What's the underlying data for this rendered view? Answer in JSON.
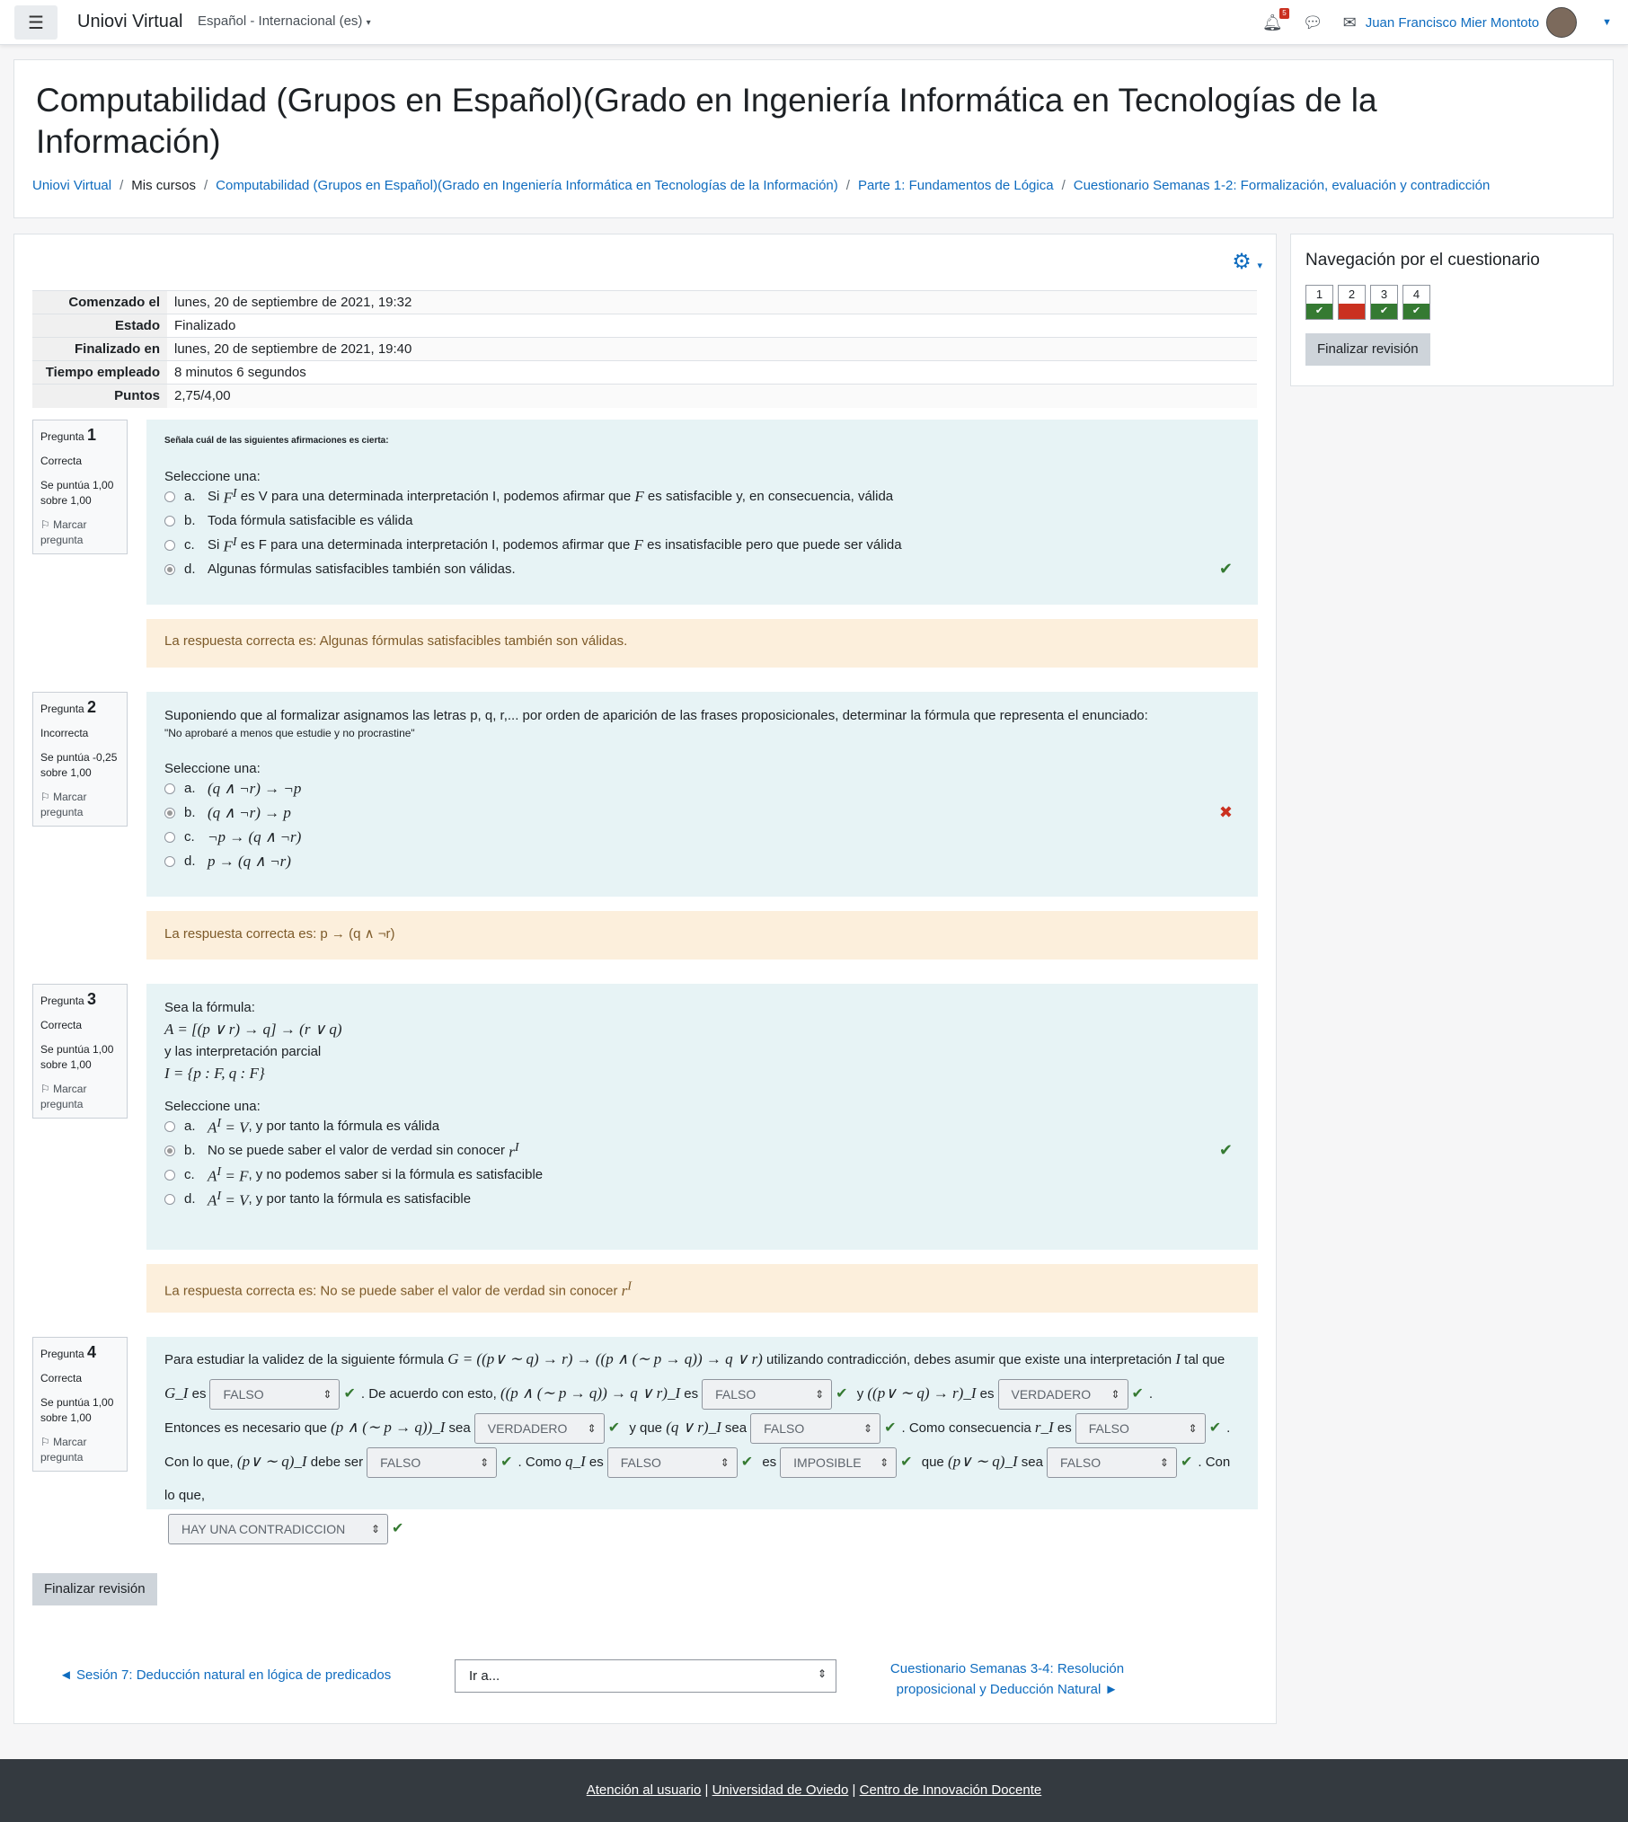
{
  "navbar": {
    "brand": "Uniovi Virtual",
    "language": "Español - Internacional (es)",
    "notification_count": "5",
    "user_name": "Juan Francisco Mier Montoto"
  },
  "header": {
    "title": "Computabilidad (Grupos en Español)(Grado en Ingeniería Informática en Tecnologías de la Información)",
    "breadcrumb": [
      "Uniovi Virtual",
      "Mis cursos",
      "Computabilidad (Grupos en Español)(Grado en Ingeniería Informática en Tecnologías de la Información)",
      "Parte 1: Fundamentos de Lógica",
      "Cuestionario Semanas 1-2: Formalización, evaluación y contradicción"
    ]
  },
  "summary": [
    {
      "label": "Comenzado el",
      "value": "lunes, 20 de septiembre de 2021, 19:32"
    },
    {
      "label": "Estado",
      "value": "Finalizado"
    },
    {
      "label": "Finalizado en",
      "value": "lunes, 20 de septiembre de 2021, 19:40"
    },
    {
      "label": "Tiempo empleado",
      "value": "8 minutos 6 segundos"
    },
    {
      "label": "Puntos",
      "value": "2,75/4,00"
    }
  ],
  "common": {
    "pregunta": "Pregunta",
    "marcar": "Marcar pregunta",
    "seleccione": "Seleccione una:"
  },
  "questions": [
    {
      "number": "1",
      "status": "Correcta",
      "score": "Se puntúa 1,00 sobre 1,00",
      "prompt": "Señala cuál de las siguientes afirmaciones es cierta:",
      "options": [
        {
          "letter": "a.",
          "text": "Si F^I es V para una determinada interpretación I, podemos afirmar que F es satisfacible y, en consecuencia, válida"
        },
        {
          "letter": "b.",
          "text": "Toda fórmula satisfacible es válida"
        },
        {
          "letter": "c.",
          "text": "Si F^I es F para una determinada interpretación I, podemos afirmar que F es insatisfacible pero que puede ser válida"
        },
        {
          "letter": "d.",
          "text": "Algunas fórmulas satisfacibles también son válidas."
        }
      ],
      "feedback": "La respuesta correcta es: Algunas fórmulas satisfacibles también son válidas."
    },
    {
      "number": "2",
      "status": "Incorrecta",
      "score": "Se puntúa -0,25 sobre 1,00",
      "prompt": "Suponiendo que al formalizar asignamos las letras p, q, r,... por orden de aparición de las frases proposicionales, determinar la fórmula que representa el enunciado:",
      "quote": "\"No aprobaré a menos que estudie y no procrastine\"",
      "options": [
        {
          "letter": "a.",
          "text": "(q ∧ ¬r) → ¬p"
        },
        {
          "letter": "b.",
          "text": "(q ∧ ¬r) → p"
        },
        {
          "letter": "c.",
          "text": "¬p → (q ∧ ¬r)"
        },
        {
          "letter": "d.",
          "text": "p → (q ∧ ¬r)"
        }
      ],
      "feedback": "La respuesta correcta es: p → (q ∧ ¬r)"
    },
    {
      "number": "3",
      "status": "Correcta",
      "score": "Se puntúa 1,00 sobre 1,00",
      "prompt": "Sea la fórmula:",
      "formula": "A = [(p ∨ r) → q] → (r ∨ q)",
      "prompt2": "y las interpretación parcial",
      "interp": "I = {p : F, q : F}",
      "options": [
        {
          "letter": "a.",
          "text": "A^I = V, y por tanto la fórmula es válida"
        },
        {
          "letter": "b.",
          "text": "No se puede saber el valor de verdad sin conocer r^I"
        },
        {
          "letter": "c.",
          "text": "A^I = F, y no podemos saber si la fórmula es satisfacible"
        },
        {
          "letter": "d.",
          "text": "A^I = V, y por tanto la fórmula es satisfacible"
        }
      ],
      "feedback": "La respuesta correcta es: No se puede saber el valor de verdad sin conocer r^I"
    },
    {
      "number": "4",
      "status": "Correcta",
      "score": "Se puntúa 1,00 sobre 1,00",
      "t1": "Para estudiar la validez de la siguiente fórmula",
      "f1": "G = ((p∨ ∼ q) → r) → ((p ∧ (∼ p → q)) → q ∨ r)",
      "t2": "utilizando contradicción, debes asumir que existe una interpretación",
      "f2": "I",
      "t3": "tal que",
      "f3": "G_I",
      "t4": "es",
      "dd1": "FALSO",
      "t5": ". De acuerdo con esto,",
      "f4": "((p ∧ (∼ p → q)) → q ∨ r)_I",
      "t6": "es",
      "dd2": "FALSO",
      "t7": "y",
      "f5": "((p∨ ∼ q) → r)_I",
      "t8": "es",
      "dd3": "VERDADERO",
      "t9": ".",
      "t10": "Entonces es necesario que",
      "f6": "(p ∧ (∼ p → q))_I",
      "t11": "sea",
      "dd4": "VERDADERO",
      "t12": "y que",
      "f7": "(q ∨ r)_I",
      "t13": "sea",
      "dd5": "FALSO",
      "t14": ". Como consecuencia",
      "f8": "r_I",
      "t15": "es",
      "dd6": "FALSO",
      "t16": ".",
      "t17": "Con lo que,",
      "f9": "(p∨ ∼ q)_I",
      "t18": "debe ser",
      "dd7": "FALSO",
      "t19": ". Como",
      "f10": "q_I",
      "t20": "es",
      "dd8": "FALSO",
      "t21": "es",
      "dd9": "IMPOSIBLE",
      "t22": "que",
      "f11": "(p∨ ∼ q)_I",
      "t23": "sea",
      "dd10": "FALSO",
      "t24": ". Con lo que,",
      "dd11": "HAY UNA CONTRADICCION"
    }
  ],
  "finish_label": "Finalizar revisión",
  "footer_nav": {
    "prev": "◄ Sesión 7: Deducción natural en lógica de predicados",
    "jump": "Ir a...",
    "next": "Cuestionario Semanas 3-4: Resolución proposicional y Deducción Natural ►"
  },
  "sidebar": {
    "title": "Navegación por el cuestionario",
    "items": [
      {
        "num": "1",
        "state": "correct"
      },
      {
        "num": "2",
        "state": "incorrect"
      },
      {
        "num": "3",
        "state": "correct"
      },
      {
        "num": "4",
        "state": "correct"
      }
    ],
    "finish_label": "Finalizar revisión"
  },
  "footer": {
    "links": [
      "Atención al usuario",
      "Universidad de Oviedo",
      "Centro de Innovación Docente"
    ],
    "separator": "|"
  },
  "colors": {
    "correct": "#357a32",
    "incorrect": "#ca3120",
    "link": "#0f6cbf"
  }
}
